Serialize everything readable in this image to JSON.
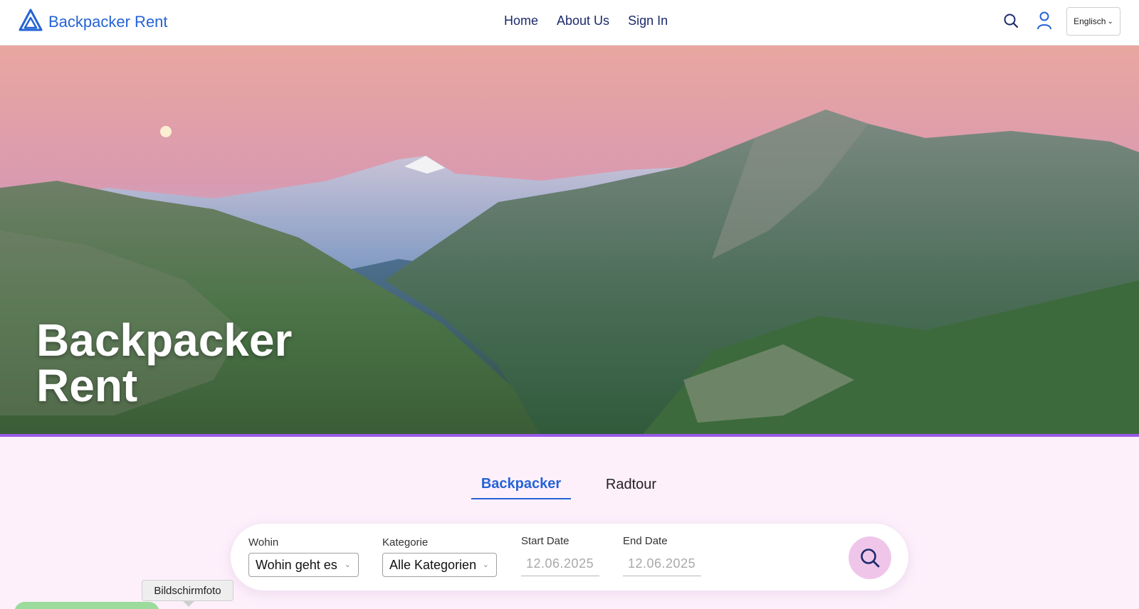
{
  "header": {
    "brand_name": "Backpacker Rent",
    "brand_color": "#2563d6",
    "logo_icon": "mountain-triangle-icon",
    "nav": [
      {
        "label": "Home"
      },
      {
        "label": "About Us"
      },
      {
        "label": "Sign In"
      }
    ],
    "search_icon": "search-icon",
    "user_icon": "user-icon",
    "language": "Englisch",
    "language_chevron": "⌄"
  },
  "hero": {
    "title_line1": "Backpacker",
    "title_line2": "Rent",
    "accent_color": "#9b59e8"
  },
  "tabs": {
    "active": "Backpacker",
    "inactive": "Radtour"
  },
  "search": {
    "where_label": "Wohin",
    "where_value": "Wohin geht es",
    "category_label": "Kategorie",
    "category_value": "Alle Kategorien",
    "start_label": "Start Date",
    "start_value": "12.06.2025",
    "end_label": "End Date",
    "end_value": "12.06.2025",
    "chevron": "⌄",
    "button_icon": "search-icon",
    "button_color": "#efc6ea"
  },
  "tooltip": {
    "text": "Bildschirmfoto"
  }
}
